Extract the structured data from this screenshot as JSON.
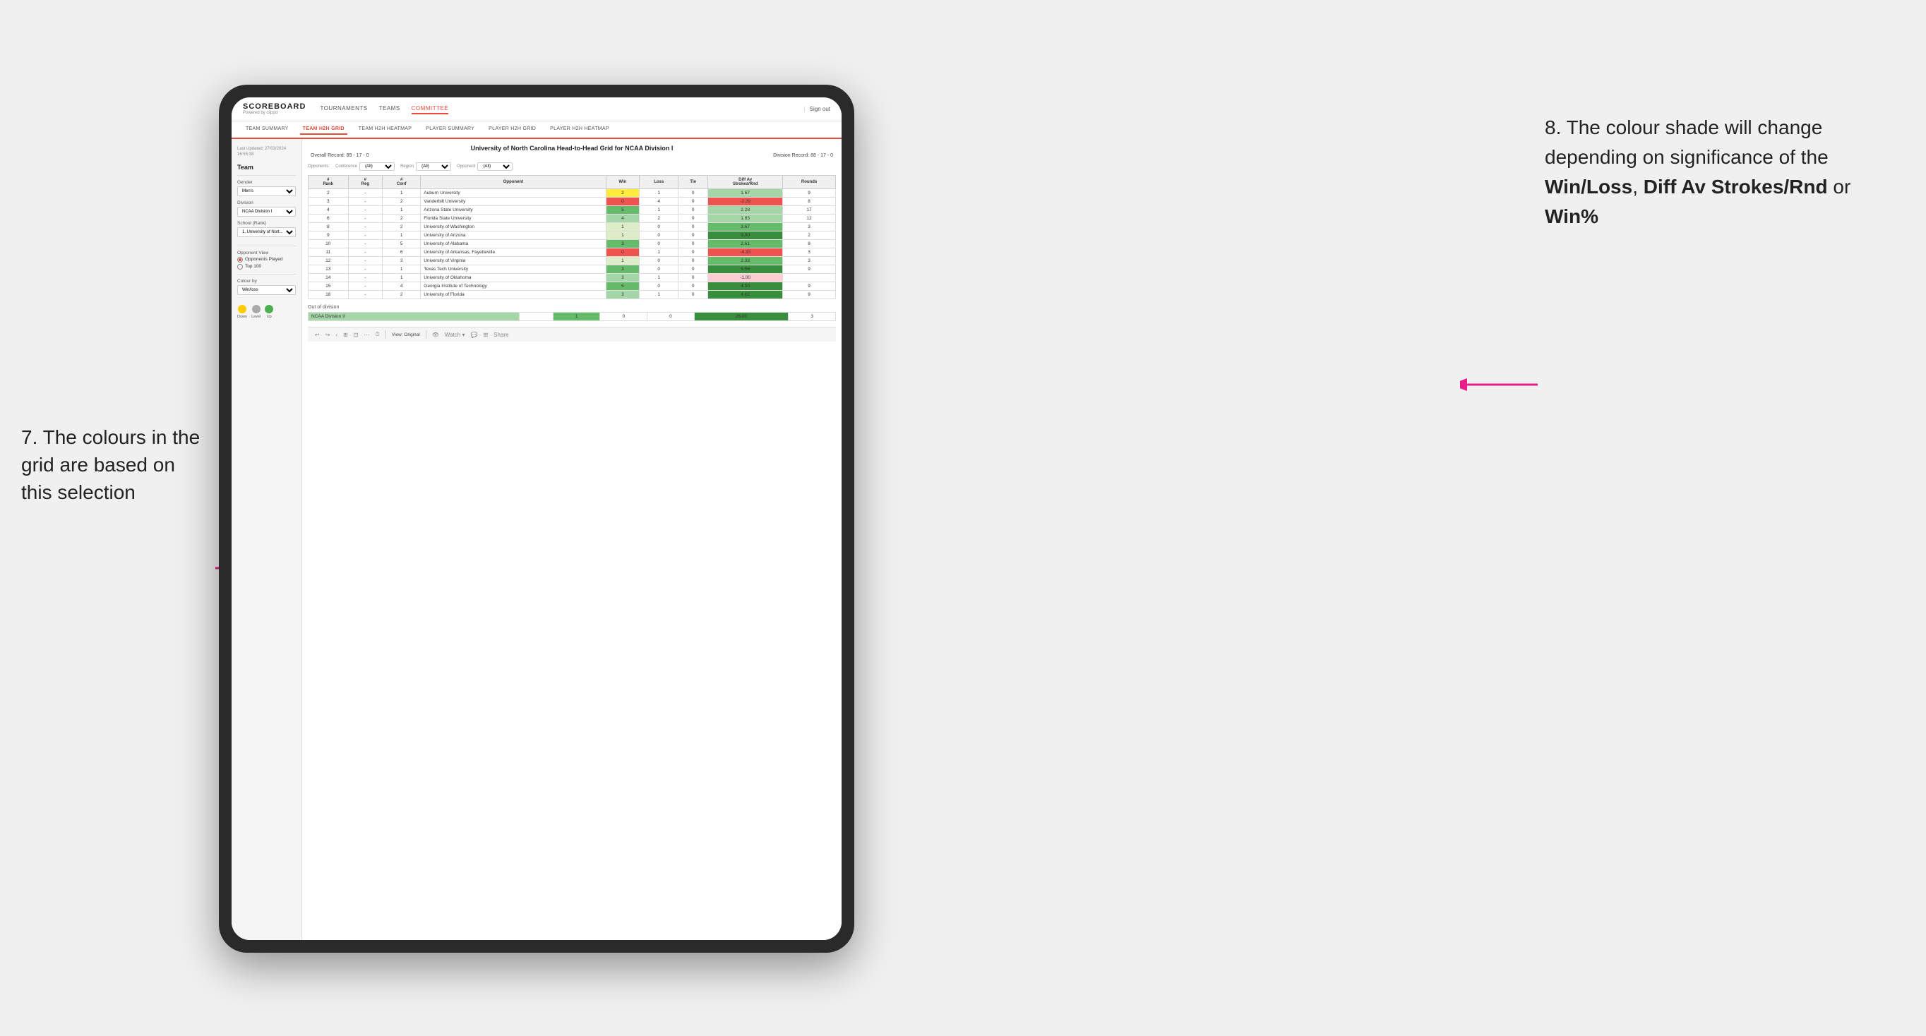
{
  "annotation_left": {
    "text": "7. The colours in the grid are based on this selection",
    "arrow_direction": "right"
  },
  "annotation_right": {
    "intro": "8. The colour shade will change depending on significance of the ",
    "bold1": "Win/Loss",
    "sep1": ", ",
    "bold2": "Diff Av Strokes/Rnd",
    "sep2": " or ",
    "bold3": "Win%"
  },
  "app": {
    "logo": "SCOREBOARD",
    "logo_sub": "Powered by clippd",
    "sign_out": "Sign out",
    "nav": [
      "TOURNAMENTS",
      "TEAMS",
      "COMMITTEE"
    ],
    "active_nav": "COMMITTEE",
    "sub_nav": [
      "TEAM SUMMARY",
      "TEAM H2H GRID",
      "TEAM H2H HEATMAP",
      "PLAYER SUMMARY",
      "PLAYER H2H GRID",
      "PLAYER H2H HEATMAP"
    ],
    "active_sub_nav": "TEAM H2H GRID"
  },
  "sidebar": {
    "last_updated": "Last Updated: 27/03/2024\n16:55:38",
    "team_section": "Team",
    "gender_label": "Gender",
    "gender_value": "Men's",
    "division_label": "Division",
    "division_value": "NCAA Division I",
    "school_label": "School (Rank)",
    "school_value": "1. University of Nort...",
    "opponent_view_label": "Opponent View",
    "opponent_options": [
      "Opponents Played",
      "Top 100"
    ],
    "selected_opponent": "Opponents Played",
    "colour_by_label": "Colour by",
    "colour_by_value": "Win/loss",
    "legend": [
      {
        "label": "Down",
        "color": "#ffcc00"
      },
      {
        "label": "Level",
        "color": "#aaaaaa"
      },
      {
        "label": "Up",
        "color": "#4caf50"
      }
    ]
  },
  "grid": {
    "title": "University of North Carolina Head-to-Head Grid for NCAA Division I",
    "overall_record": "Overall Record: 89 - 17 - 0",
    "division_record": "Division Record: 88 - 17 - 0",
    "filters": {
      "opponents_label": "Opponents:",
      "conference_label": "Conference",
      "conference_value": "(All)",
      "region_label": "Region",
      "region_value": "(All)",
      "opponent_label": "Opponent",
      "opponent_value": "(All)"
    },
    "columns": [
      "#\nRank",
      "#\nReg",
      "#\nConf",
      "Opponent",
      "Win",
      "Loss",
      "Tie",
      "Diff Av\nStrokes/Rnd",
      "Rounds"
    ],
    "rows": [
      {
        "rank": "2",
        "reg": "-",
        "conf": "1",
        "opponent": "Auburn University",
        "win": "2",
        "loss": "1",
        "tie": "0",
        "diff": "1.67",
        "rounds": "9",
        "win_color": "yellow",
        "diff_color": "green_light"
      },
      {
        "rank": "3",
        "reg": "-",
        "conf": "2",
        "opponent": "Vanderbilt University",
        "win": "0",
        "loss": "4",
        "tie": "0",
        "diff": "-2.29",
        "rounds": "8",
        "win_color": "red",
        "diff_color": "red"
      },
      {
        "rank": "4",
        "reg": "-",
        "conf": "1",
        "opponent": "Arizona State University",
        "win": "5",
        "loss": "1",
        "tie": "0",
        "diff": "2.28",
        "rounds": "",
        "win_color": "green_dark",
        "diff_color": "green"
      },
      {
        "rank": "6",
        "reg": "-",
        "conf": "2",
        "opponent": "Florida State University",
        "win": "4",
        "loss": "2",
        "tie": "0",
        "diff": "1.83",
        "rounds": "12",
        "win_color": "green_mid",
        "diff_color": "green_light"
      },
      {
        "rank": "8",
        "reg": "-",
        "conf": "2",
        "opponent": "University of Washington",
        "win": "1",
        "loss": "0",
        "tie": "0",
        "diff": "3.67",
        "rounds": "3",
        "win_color": "green_light",
        "diff_color": "green"
      },
      {
        "rank": "9",
        "reg": "-",
        "conf": "1",
        "opponent": "University of Arizona",
        "win": "1",
        "loss": "0",
        "tie": "0",
        "diff": "9.00",
        "rounds": "2",
        "win_color": "green_light",
        "diff_color": "green_dark"
      },
      {
        "rank": "10",
        "reg": "-",
        "conf": "5",
        "opponent": "University of Alabama",
        "win": "3",
        "loss": "0",
        "tie": "0",
        "diff": "2.61",
        "rounds": "8",
        "win_color": "green_dark",
        "diff_color": "green"
      },
      {
        "rank": "11",
        "reg": "-",
        "conf": "6",
        "opponent": "University of Arkansas, Fayetteville",
        "win": "0",
        "loss": "1",
        "tie": "0",
        "diff": "-4.33",
        "rounds": "3",
        "win_color": "red",
        "diff_color": "red"
      },
      {
        "rank": "12",
        "reg": "-",
        "conf": "3",
        "opponent": "University of Virginia",
        "win": "1",
        "loss": "0",
        "tie": "0",
        "diff": "2.33",
        "rounds": "3",
        "win_color": "green_light",
        "diff_color": "green"
      },
      {
        "rank": "13",
        "reg": "-",
        "conf": "1",
        "opponent": "Texas Tech University",
        "win": "3",
        "loss": "0",
        "tie": "0",
        "diff": "5.56",
        "rounds": "9",
        "win_color": "green_dark",
        "diff_color": "green_dark"
      },
      {
        "rank": "14",
        "reg": "-",
        "conf": "1",
        "opponent": "University of Oklahoma",
        "win": "3",
        "loss": "1",
        "tie": "0",
        "diff": "-1.00",
        "rounds": "",
        "win_color": "green_mid",
        "diff_color": "red_light"
      },
      {
        "rank": "15",
        "reg": "-",
        "conf": "4",
        "opponent": "Georgia Institute of Technology",
        "win": "5",
        "loss": "0",
        "tie": "0",
        "diff": "4.50",
        "rounds": "9",
        "win_color": "green_dark",
        "diff_color": "green_dark"
      },
      {
        "rank": "16",
        "reg": "-",
        "conf": "2",
        "opponent": "University of Florida",
        "win": "3",
        "loss": "1",
        "tie": "0",
        "diff": "4.62",
        "rounds": "9",
        "win_color": "green_mid",
        "diff_color": "green_dark"
      }
    ],
    "out_of_division": {
      "title": "Out of division",
      "row": {
        "division": "NCAA Division II",
        "win": "1",
        "loss": "0",
        "tie": "0",
        "diff": "26.00",
        "rounds": "3",
        "color": "green_mid"
      }
    }
  },
  "toolbar": {
    "view_label": "View: Original",
    "watch_label": "Watch",
    "share_label": "Share"
  }
}
